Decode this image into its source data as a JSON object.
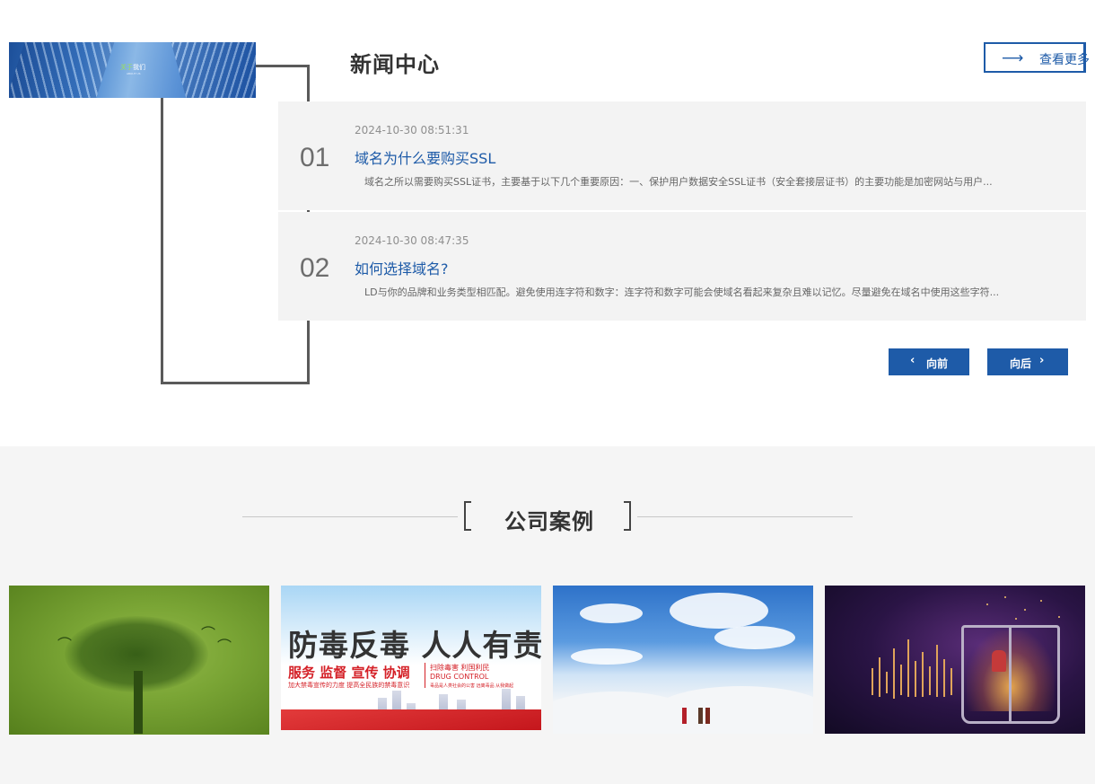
{
  "news": {
    "title": "新闻中心",
    "more_label": "查看更多",
    "banner": {
      "title_highlight": "关于",
      "title_rest": "我们",
      "subtitle": "ABOUT US"
    },
    "items": [
      {
        "num": "01",
        "date": "2024-10-30 08:51:31",
        "headline": "域名为什么要购买SSL",
        "summary": "域名之所以需要购买SSL证书，主要基于以下几个重要原因：一、保护用户数据安全SSL证书（安全套接层证书）的主要功能是加密网站与用户..."
      },
      {
        "num": "02",
        "date": "2024-10-30 08:47:35",
        "headline": "如何选择域名?",
        "summary": "LD与你的品牌和业务类型相匹配。避免使用连字符和数字：连字符和数字可能会使域名看起来复杂且难以记忆。尽量避免在域名中使用这些字符..."
      }
    ],
    "prev_label": "向前",
    "next_label": "向后",
    "prev_icon": "‹",
    "next_icon": "›",
    "arrow_icon": "⟶"
  },
  "cases": {
    "title": "公司案例",
    "poster": {
      "main": "防毒反毒 人人有责",
      "sub": "服务 监督 宣传 协调",
      "small": "加大禁毒宣传的力度 提高全民族的禁毒意识",
      "right1": "扫除毒害 利国利民",
      "right2": "DRUG CONTROL",
      "right3": "毒品是人类社会的公害 远离毒品 从我做起"
    }
  },
  "colors": {
    "accent": "#1e5ba8",
    "item_bg": "#f3f3f3",
    "section_bg": "#f5f5f5",
    "frame": "#5a5a5a"
  }
}
